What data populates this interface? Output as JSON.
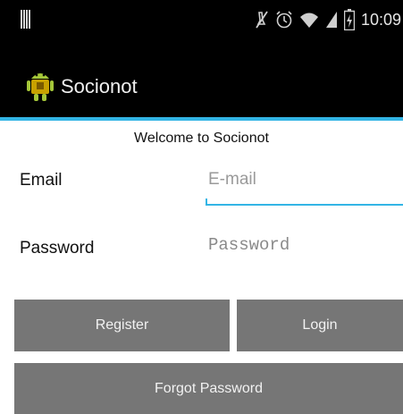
{
  "status_bar": {
    "time": "10:09",
    "icons": [
      "signal-bars-icon",
      "mute-icon",
      "alarm-icon",
      "wifi-icon",
      "signal-icon",
      "battery-icon"
    ]
  },
  "action_bar": {
    "app_name": "Socionot",
    "app_icon": "android-icon",
    "accent_color": "#33b5e5"
  },
  "form": {
    "welcome_text": "Welcome to Socionot",
    "email_label": "Email",
    "email_placeholder": "E-mail",
    "email_value": "",
    "password_label": "Password",
    "password_placeholder": "Password",
    "password_value": ""
  },
  "buttons": {
    "register_label": "Register",
    "login_label": "Login",
    "forgot_label": "Forgot Password",
    "button_color": "#767676"
  }
}
